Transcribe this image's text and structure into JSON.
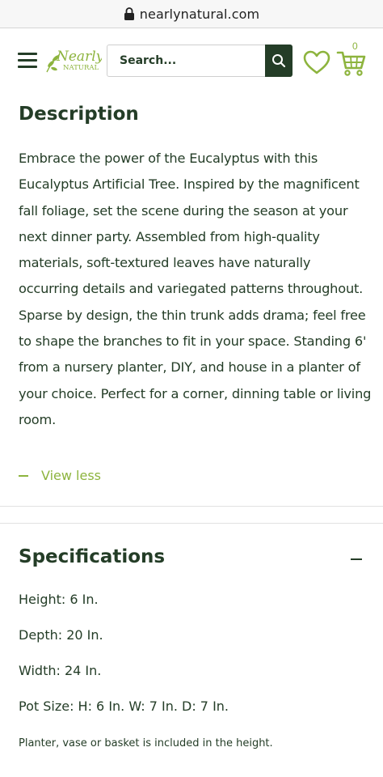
{
  "browser": {
    "url": "nearlynatural.com"
  },
  "header": {
    "logo_top": "Nearly",
    "logo_bottom": "NATURAL",
    "search_placeholder": "Search...",
    "cart_count": "0"
  },
  "description": {
    "title": "Description",
    "body": "Embrace the power of the Eucalyptus with this Eucalyptus Artificial Tree. Inspired by the magnificent fall foliage, set the scene during the season at your next dinner party. Assembled from high-quality materials, soft-textured leaves have naturally occurring details and variegated patterns throughout. Sparse by design, the thin trunk adds drama; feel free to shape the branches to fit in your space. Standing 6' from a nursery planter, DIY, and house in a planter of your choice. Perfect for a corner, dinning table or living room.",
    "toggle_label": "View less"
  },
  "specifications": {
    "title": "Specifications",
    "items": [
      "Height: 6 In.",
      "Depth: 20 In.",
      "Width: 24 In.",
      "Pot Size: H: 6 In. W: 7 In. D: 7 In."
    ],
    "note": "Planter, vase or basket is included in the height."
  },
  "colors": {
    "brand_dark": "#243d27",
    "brand_green": "#8db43e"
  }
}
